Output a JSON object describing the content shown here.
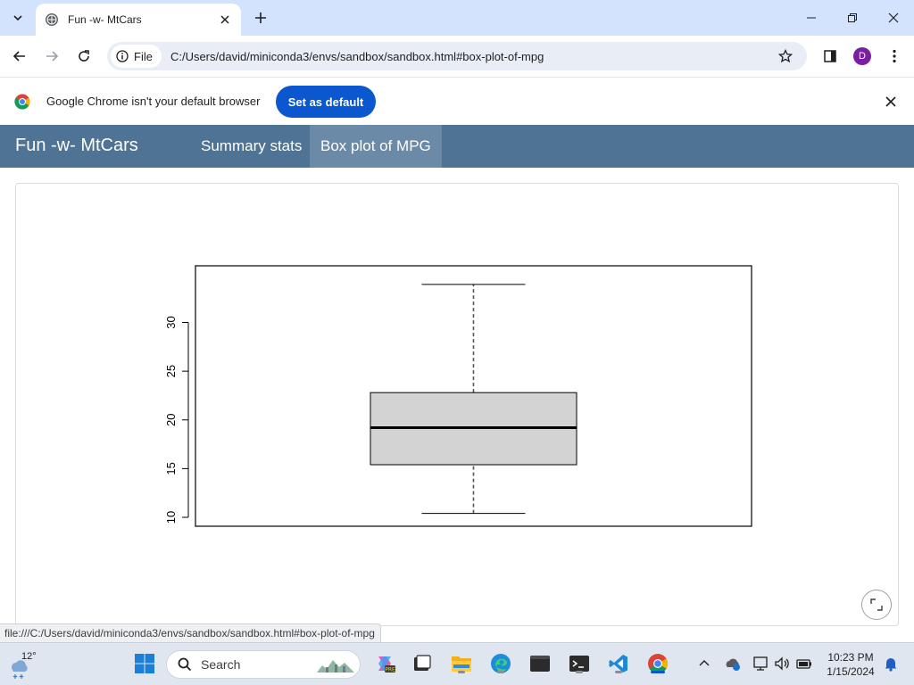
{
  "browser": {
    "tab_title": "Fun -w- MtCars",
    "address_chip_label": "File",
    "url": "C:/Users/david/miniconda3/envs/sandbox/sandbox.html#box-plot-of-mpg",
    "profile_initial": "D",
    "infobar_message": "Google Chrome isn't your default browser",
    "infobar_button": "Set as default",
    "status_url": "file:///C:/Users/david/miniconda3/envs/sandbox/sandbox.html#box-plot-of-mpg"
  },
  "app": {
    "title": "Fun -w- MtCars",
    "nav": [
      {
        "label": "Summary stats",
        "active": false
      },
      {
        "label": "Box plot of MPG",
        "active": true
      }
    ]
  },
  "chart_data": {
    "type": "box",
    "title": "",
    "xlabel": "",
    "ylabel": "",
    "ylim": [
      10,
      34.9
    ],
    "yticks": [
      "10",
      "15",
      "20",
      "25",
      "30"
    ],
    "series": [
      {
        "min": 10.4,
        "q1": 15.4,
        "median": 19.2,
        "q3": 22.8,
        "max": 33.9
      }
    ]
  },
  "taskbar": {
    "weather_temp": "12°",
    "search_label": "Search",
    "time": "10:23 PM",
    "date": "1/15/2024"
  },
  "colors": {
    "tab_strip": "#d3e3fd",
    "primary_button": "#0b57d0",
    "app_bar": "#4e7395",
    "app_bar_active": "#6a8aa8",
    "box_fill": "#d3d3d3"
  }
}
